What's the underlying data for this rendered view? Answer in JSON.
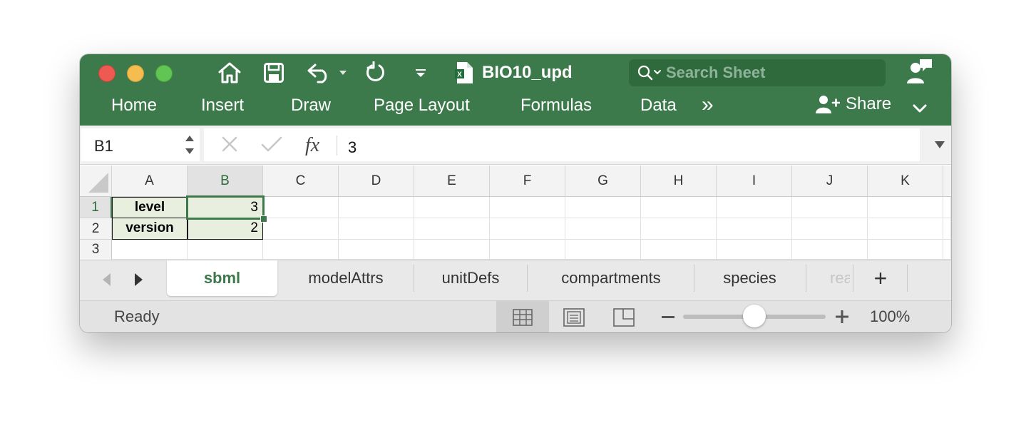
{
  "app": {
    "title": "BIO10_upd",
    "search_placeholder": "Search Sheet"
  },
  "ribbon": {
    "tabs": [
      "Home",
      "Insert",
      "Draw",
      "Page Layout",
      "Formulas",
      "Data"
    ],
    "more": "»",
    "share": "Share"
  },
  "formula_bar": {
    "name_box": "B1",
    "fx": "fx",
    "value": "3"
  },
  "grid": {
    "columns": [
      "A",
      "B",
      "C",
      "D",
      "E",
      "F",
      "G",
      "H",
      "I",
      "J",
      "K"
    ],
    "rows": [
      "1",
      "2",
      "3"
    ],
    "cells": {
      "A1": "level",
      "B1": "3",
      "A2": "version",
      "B2": "2"
    },
    "selected_cell": "B1"
  },
  "sheets": {
    "tabs": [
      "sbml",
      "modelAttrs",
      "unitDefs",
      "compartments",
      "species",
      "rea"
    ],
    "active": "sbml",
    "add": "+"
  },
  "status": {
    "text": "Ready",
    "zoom": "100%",
    "zoom_level": 1.0
  },
  "colors": {
    "accent": "#3d7a4b",
    "header_fill": "#e8efdf"
  }
}
